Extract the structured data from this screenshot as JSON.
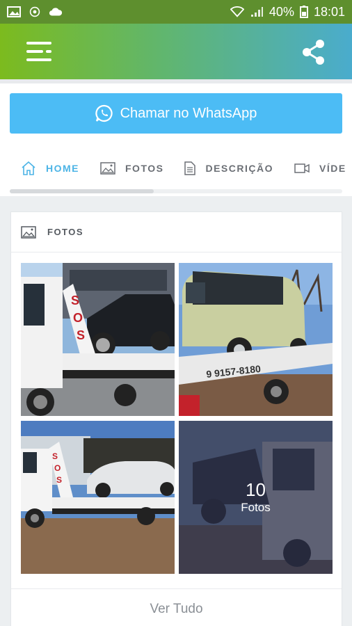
{
  "status_bar": {
    "battery": "40%",
    "time": "18:01"
  },
  "app_bar": {
    "menu_icon": "menu-icon",
    "share_icon": "share-icon"
  },
  "whatsapp_button": {
    "label": "Chamar no WhatsApp",
    "icon": "whatsapp-icon"
  },
  "tabs": [
    {
      "label": "HOME",
      "icon": "home-icon",
      "active": true
    },
    {
      "label": "FOTOS",
      "icon": "image-icon",
      "active": false
    },
    {
      "label": "DESCRIÇÃO",
      "icon": "document-icon",
      "active": false
    },
    {
      "label": "VÍDE",
      "icon": "video-icon",
      "active": false
    }
  ],
  "photos_card": {
    "title": "FOTOS",
    "more_count": "10",
    "more_label": "Fotos",
    "see_all": "Ver Tudo"
  },
  "colors": {
    "accent": "#4cbcf5",
    "active_tab": "#4cb4e6",
    "gradient_start": "#7cbb1e",
    "gradient_end": "#4aaccd"
  }
}
